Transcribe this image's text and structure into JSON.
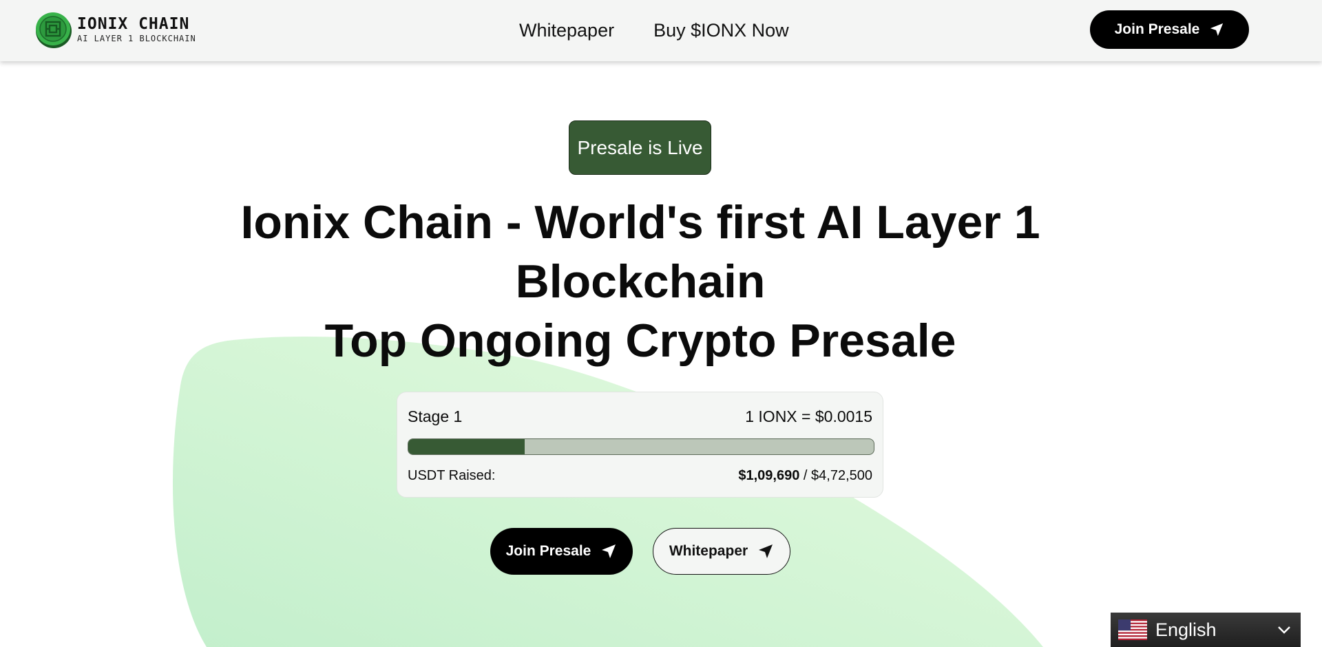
{
  "header": {
    "logo_title": "IONIX CHAIN",
    "logo_subtitle": "AI LAYER 1 BLOCKCHAIN",
    "nav": [
      {
        "label": "Whitepaper"
      },
      {
        "label": "Buy $IONX Now"
      }
    ],
    "cta_label": "Join Presale"
  },
  "hero": {
    "badge": "Presale is Live",
    "title_lines": [
      "Ionix Chain - World's first AI Layer 1",
      "Blockchain",
      "Top Ongoing Crypto Presale"
    ]
  },
  "presale": {
    "stage": "Stage 1",
    "price": "1 IONX = $0.0015",
    "progress_fraction": 0.25,
    "raised_label": "USDT Raised:",
    "raised_amount": "$1,09,690",
    "raised_separator": " / ",
    "raised_goal": "$4,72,500"
  },
  "buttons": {
    "join_label": "Join Presale",
    "whitepaper_label": "Whitepaper"
  },
  "language": {
    "selected": "English",
    "flag_icon": "us-flag-icon"
  },
  "colors": {
    "accent_green": "#375a34",
    "dark": "#000000",
    "blob_green": "#c9f2cf"
  }
}
